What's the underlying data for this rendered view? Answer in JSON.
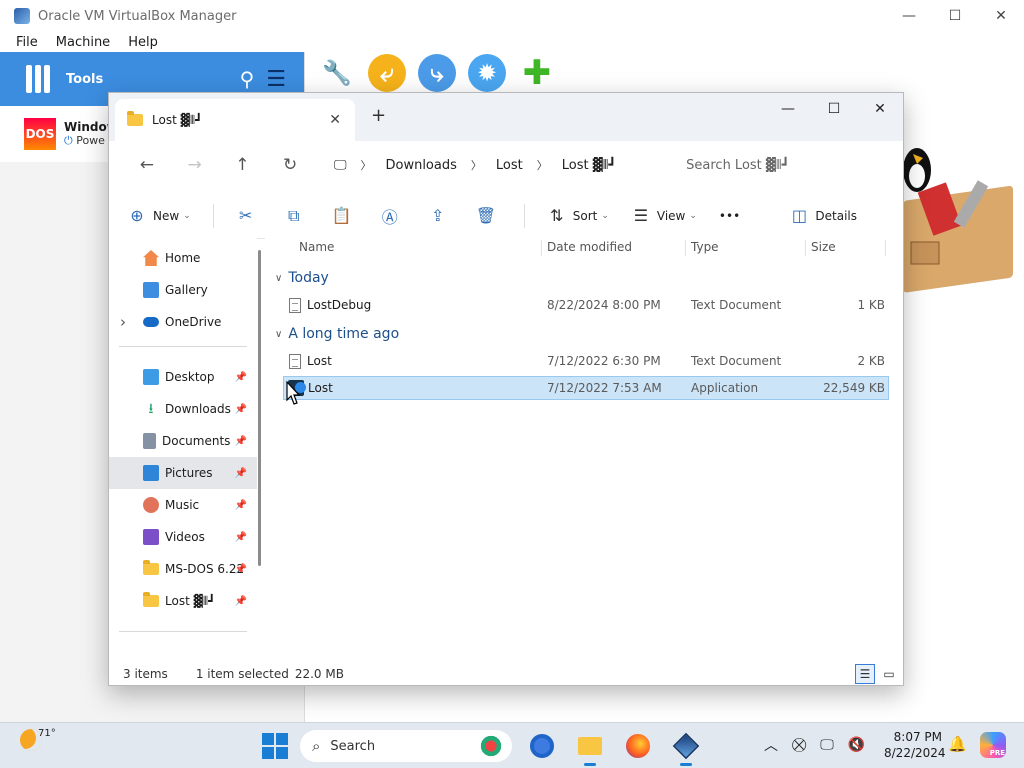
{
  "vbox": {
    "title": "Oracle VM VirtualBox Manager",
    "menu": [
      "File",
      "Machine",
      "Help"
    ],
    "tools_label": "Tools",
    "vm_name": "Window",
    "vm_state": "Powe",
    "vm_badge": "DOS"
  },
  "explorer": {
    "tab_title": "Lost ▓⦀┛",
    "breadcrumbs": [
      "Downloads",
      "Lost",
      "Lost ▓⦀┛"
    ],
    "search_placeholder": "Search Lost ▓⦀┛",
    "commands": {
      "new": "New",
      "sort": "Sort",
      "view": "View",
      "more": "•••",
      "details": "Details"
    },
    "nav": {
      "home": "Home",
      "gallery": "Gallery",
      "onedrive": "OneDrive",
      "desktop": "Desktop",
      "downloads": "Downloads",
      "documents": "Documents",
      "pictures": "Pictures",
      "music": "Music",
      "videos": "Videos",
      "msdos": "MS-DOS 6.22",
      "lost": "Lost ▓⦀┛"
    },
    "columns": {
      "name": "Name",
      "date": "Date modified",
      "type": "Type",
      "size": "Size"
    },
    "groups": [
      {
        "label": "Today",
        "files": [
          {
            "name": "LostDebug",
            "date": "8/22/2024 8:00 PM",
            "type": "Text Document",
            "size": "1 KB"
          }
        ]
      },
      {
        "label": "A long time ago",
        "files": [
          {
            "name": "Lost",
            "date": "7/12/2022 6:30 PM",
            "type": "Text Document",
            "size": "2 KB"
          },
          {
            "name": "Lost",
            "date": "7/12/2022 7:53 AM",
            "type": "Application",
            "size": "22,549 KB"
          }
        ]
      }
    ],
    "status": {
      "items": "3 items",
      "selected": "1 item selected",
      "size": "22.0 MB"
    }
  },
  "taskbar": {
    "temperature": "71°",
    "search_label": "Search",
    "time": "8:07 PM",
    "date": "8/22/2024",
    "copilot_badge": "PRE"
  },
  "colors": {
    "accent": "#1a7fd4",
    "selection": "#cce4f7",
    "vbox_tools": "#3c8de0",
    "folder": "#f8c643"
  },
  "icons": {
    "tab": "folder-icon",
    "nav_back": "arrow-left-icon",
    "nav_forward": "arrow-right-icon",
    "nav_up": "arrow-up-icon",
    "refresh": "refresh-icon",
    "computer": "monitor-icon"
  }
}
